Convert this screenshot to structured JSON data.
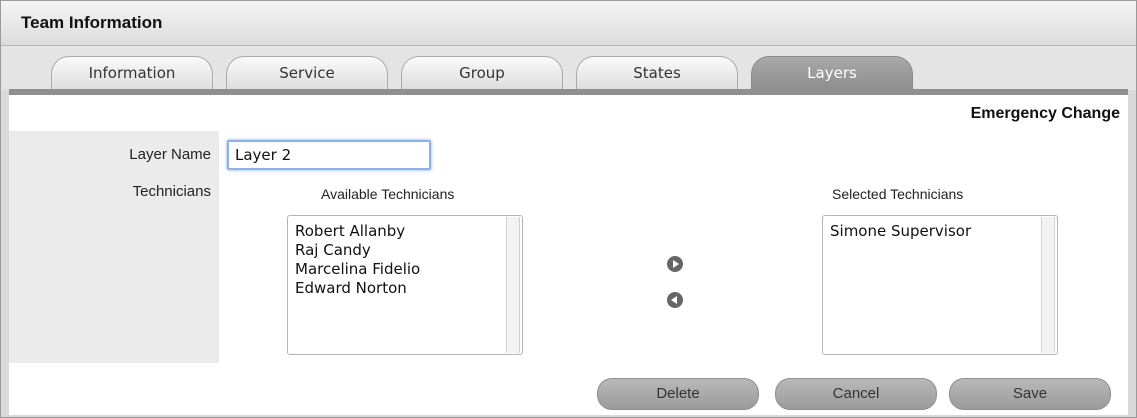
{
  "panel": {
    "title": "Team Information"
  },
  "tabs": [
    {
      "label": "Information"
    },
    {
      "label": "Service"
    },
    {
      "label": "Group"
    },
    {
      "label": "States"
    },
    {
      "label": "Layers"
    }
  ],
  "section": {
    "heading": "Emergency Change"
  },
  "form": {
    "layer_name_label": "Layer Name",
    "layer_name_value": "Layer 2",
    "technicians_label": "Technicians"
  },
  "available": {
    "header": "Available Technicians",
    "items": [
      "Robert Allanby",
      "Raj Candy",
      "Marcelina Fidelio",
      "Edward Norton"
    ]
  },
  "selected": {
    "header": "Selected Technicians",
    "items": [
      "Simone Supervisor"
    ]
  },
  "buttons": {
    "delete": "Delete",
    "cancel": "Cancel",
    "save": "Save"
  }
}
